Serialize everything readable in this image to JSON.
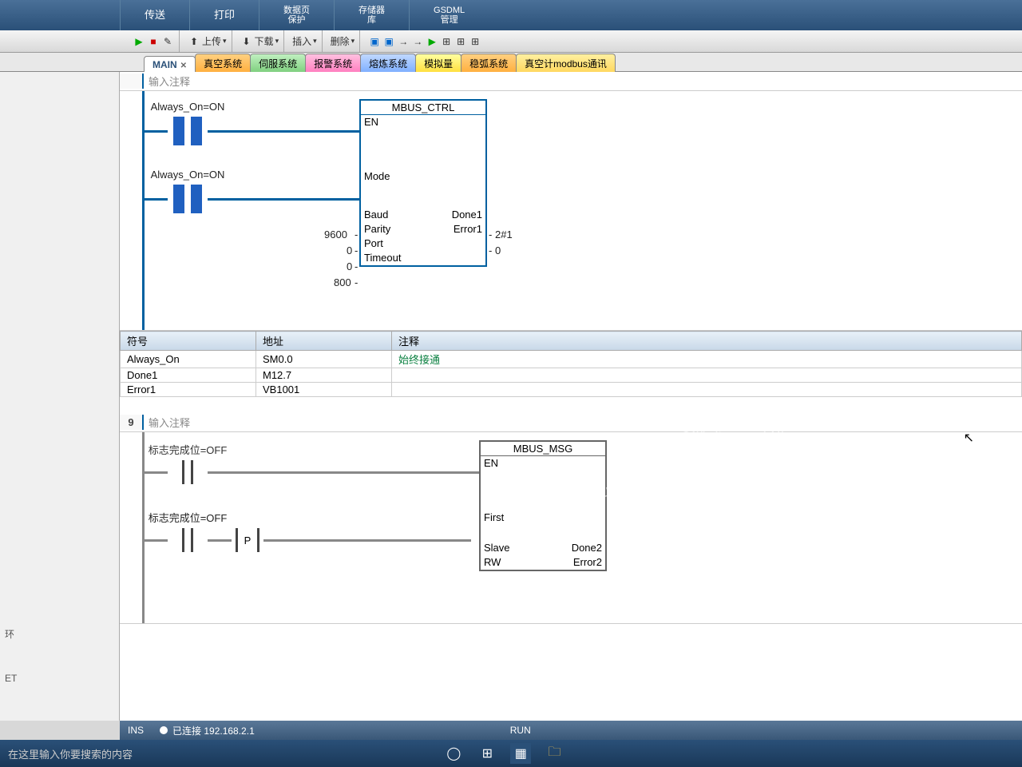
{
  "topmenu": {
    "transfer": "传送",
    "print": "打印",
    "datapage": "数据页\n保护",
    "storage": "存储器\n库",
    "gsdml": "GSDML\n管理",
    "gsdml2": "GSDML"
  },
  "subtoolbar": {
    "upload": "上传",
    "download": "下载",
    "insert": "插入",
    "delete": "删除"
  },
  "tabs": [
    {
      "label": "MAIN",
      "cls": "active"
    },
    {
      "label": "真空系统",
      "cls": "c-orange"
    },
    {
      "label": "伺服系统",
      "cls": "c-green"
    },
    {
      "label": "报警系统",
      "cls": "c-pink"
    },
    {
      "label": "熔炼系统",
      "cls": "c-blue"
    },
    {
      "label": "模拟量",
      "cls": "c-yellow"
    },
    {
      "label": "稳弧系统",
      "cls": "c-orange"
    },
    {
      "label": "真空计modbus通讯",
      "cls": "c-yellow2"
    }
  ],
  "net1": {
    "comment": "输入注释",
    "contact1": {
      "tag": "Always_On=ON"
    },
    "contact2": {
      "tag": "Always_On=ON"
    },
    "fbox": {
      "title": "MBUS_CTRL",
      "pins_left": [
        "EN",
        "",
        "Mode",
        "",
        "Baud",
        "Parity",
        "Port",
        "Timeout"
      ],
      "pins_right": [
        "",
        "",
        "",
        "",
        "Done1",
        "Error1",
        "",
        ""
      ],
      "in_vals": {
        "baud": "9600",
        "parity": "0",
        "port": "0",
        "timeout": "800"
      },
      "out_vals": {
        "done": "2#1",
        "error": "0"
      }
    }
  },
  "symtable": {
    "headers": {
      "sym": "符号",
      "addr": "地址",
      "comment": "注释"
    },
    "rows": [
      {
        "s": "Always_On",
        "a": "SM0.0",
        "c": "始终接通"
      },
      {
        "s": "Done1",
        "a": "M12.7",
        "c": ""
      },
      {
        "s": "Error1",
        "a": "VB1001",
        "c": ""
      }
    ]
  },
  "net2": {
    "num": "9",
    "comment": "输入注释",
    "contact1": {
      "tag": "标志完成位=OFF"
    },
    "contact2": {
      "tag": "标志完成位=OFF"
    },
    "p": "P",
    "fbox": {
      "title": "MBUS_MSG",
      "pins_left": [
        "EN",
        "",
        "First",
        "",
        "Slave",
        "RW"
      ],
      "pins_right": [
        "",
        "",
        "",
        "",
        "Done2",
        "Error2"
      ]
    }
  },
  "leftpane": {
    "l1": "环",
    "l2": "ET"
  },
  "status": {
    "ins": "INS",
    "conn": "已连接 192.168.2.1",
    "run": "RUN"
  },
  "taskbar": {
    "search": "在这里输入你要搜索的内容"
  },
  "watermark": "西门子工业  找答案\nsupport.industry.siemens.com/cs"
}
